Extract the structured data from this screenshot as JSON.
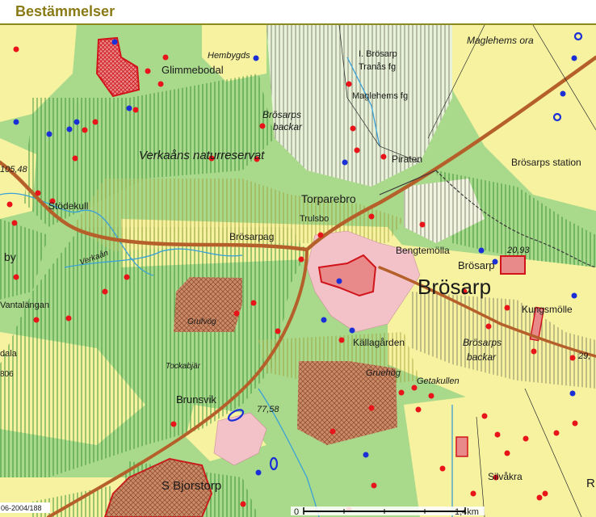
{
  "header": {
    "title": "Bestämmelser"
  },
  "map": {
    "colors": {
      "forest": "#a9d98a",
      "field": "#f6f2a0",
      "reserve_hatch": "#2f8a2f",
      "zone_hatch": "#c9c050",
      "urban": "#f3c2c8",
      "road": "#b5602a",
      "brown_area": "#c98a6a",
      "marker_red": "#e8141a",
      "marker_blue": "#1a2fd6"
    },
    "labels": {
      "hembygds": "Hembygds",
      "glimmebodal": "Glimmebodal",
      "maglehems_ora": "Maglehems ora",
      "brosarp_tranas": "I. Brösarp",
      "tranas_fg": "Tranås fg",
      "maglehems_fg": "Maglehems fg",
      "brosarps": "Brösarps",
      "backar": "backar",
      "verkaans": "Verkaåns naturreservat",
      "piraten": "Piraten",
      "brosarps_station": "Brösarps station",
      "stodekull": "Stödekull",
      "torparebro": "Torparebro",
      "trulsbo": "Trulsbo",
      "brosarpag": "Brösarpag",
      "bengtemolla": "Bengtemölla",
      "brosarp_small": "Brösarp",
      "brosarp_big": "Brösarp",
      "kungsmolle": "Kungsmölle",
      "verkaan": "Verkaån",
      "by": "by",
      "vantalangan": "Vantalängan",
      "dala": "dala",
      "kallagarden": "Källagården",
      "brosarps_backar2": "Brösarps",
      "backar2": "backar",
      "gruehog": "Gruehög",
      "getakullen": "Getakullen",
      "tockabjar": "Tockabjär",
      "brunsvik": "Brunsvik",
      "s_bjorstorp": "S Bjorstorp",
      "silvakra": "Silvåkra",
      "grufvog": "Grufvög",
      "elev_105": "105,48",
      "elev_77": "77,58",
      "elev_20": "20,93",
      "elev_29": "29,",
      "code_806": "806",
      "code_06_2004": "06-2004/188",
      "r_label": "R"
    },
    "scale": {
      "zero": "0",
      "distance": "1,4km"
    }
  }
}
